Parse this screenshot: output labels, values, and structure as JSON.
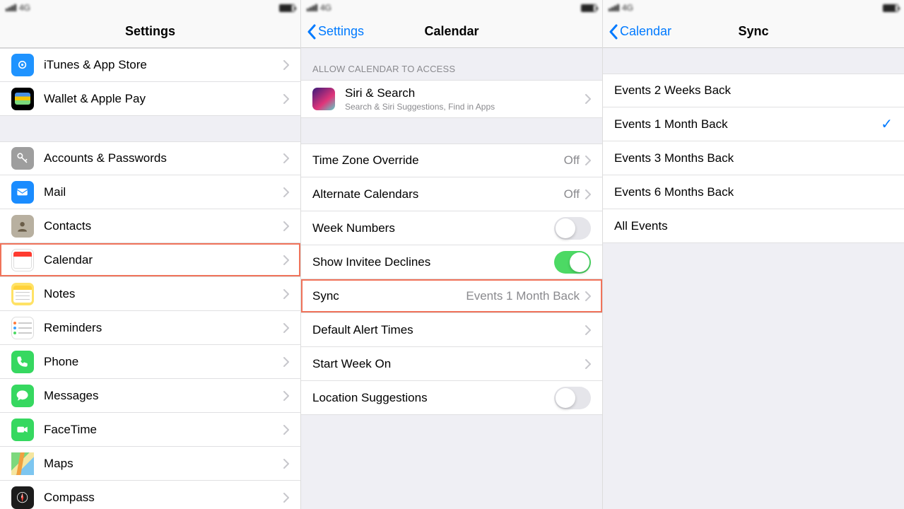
{
  "status": {
    "network": "4G"
  },
  "panel1": {
    "title": "Settings",
    "groups": [
      {
        "items": [
          {
            "icon": "itunes",
            "label": "iTunes & App Store"
          },
          {
            "icon": "wallet",
            "label": "Wallet & Apple Pay"
          }
        ]
      },
      {
        "items": [
          {
            "icon": "accounts",
            "label": "Accounts & Passwords"
          },
          {
            "icon": "mail",
            "label": "Mail"
          },
          {
            "icon": "contacts",
            "label": "Contacts"
          },
          {
            "icon": "calendar",
            "label": "Calendar",
            "highlight": true
          },
          {
            "icon": "notes",
            "label": "Notes"
          },
          {
            "icon": "reminders",
            "label": "Reminders"
          },
          {
            "icon": "phone",
            "label": "Phone"
          },
          {
            "icon": "messages",
            "label": "Messages"
          },
          {
            "icon": "facetime",
            "label": "FaceTime"
          },
          {
            "icon": "maps",
            "label": "Maps"
          },
          {
            "icon": "compass",
            "label": "Compass"
          }
        ]
      }
    ]
  },
  "panel2": {
    "back": "Settings",
    "title": "Calendar",
    "section_header": "ALLOW CALENDAR TO ACCESS",
    "siri": {
      "label": "Siri & Search",
      "sub": "Search & Siri Suggestions, Find in Apps"
    },
    "rows": [
      {
        "key": "tz",
        "label": "Time Zone Override",
        "value": "Off",
        "control": "link"
      },
      {
        "key": "alt",
        "label": "Alternate Calendars",
        "value": "Off",
        "control": "link"
      },
      {
        "key": "week",
        "label": "Week Numbers",
        "control": "toggle",
        "on": false
      },
      {
        "key": "inv",
        "label": "Show Invitee Declines",
        "control": "toggle",
        "on": true
      },
      {
        "key": "sync",
        "label": "Sync",
        "value": "Events 1 Month Back",
        "control": "link",
        "highlight": true
      },
      {
        "key": "alert",
        "label": "Default Alert Times",
        "control": "link"
      },
      {
        "key": "start",
        "label": "Start Week On",
        "control": "link"
      },
      {
        "key": "loc",
        "label": "Location Suggestions",
        "control": "toggle",
        "on": false
      }
    ]
  },
  "panel3": {
    "back": "Calendar",
    "title": "Sync",
    "options": [
      {
        "label": "Events 2 Weeks Back",
        "selected": false
      },
      {
        "label": "Events 1 Month Back",
        "selected": true
      },
      {
        "label": "Events 3 Months Back",
        "selected": false
      },
      {
        "label": "Events 6 Months Back",
        "selected": false
      },
      {
        "label": "All Events",
        "selected": false
      }
    ]
  },
  "icons": {
    "itunes": {
      "bg": "#1f93ff",
      "shape": "music"
    },
    "wallet": {
      "bg": "#000000",
      "shape": "wallet"
    },
    "accounts": {
      "bg": "#9e9e9e",
      "shape": "key"
    },
    "mail": {
      "bg": "#1a8cff",
      "shape": "mail"
    },
    "contacts": {
      "bg": "#b8b0a0",
      "shape": "contact"
    },
    "calendar": {
      "bg": "#ffffff",
      "shape": "calendar"
    },
    "notes": {
      "bg": "#ffe266",
      "shape": "notes"
    },
    "reminders": {
      "bg": "#ffffff",
      "shape": "reminders"
    },
    "phone": {
      "bg": "#36d860",
      "shape": "phone"
    },
    "messages": {
      "bg": "#36d860",
      "shape": "message"
    },
    "facetime": {
      "bg": "#36d860",
      "shape": "video"
    },
    "maps": {
      "bg": "#ffffff",
      "shape": "maps"
    },
    "compass": {
      "bg": "#1c1c1c",
      "shape": "compass"
    },
    "siri": {
      "bg": "#1a1038",
      "shape": "siri"
    }
  }
}
